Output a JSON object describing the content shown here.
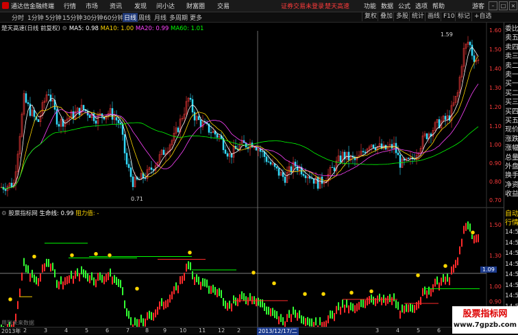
{
  "menubar": {
    "app_title": "通达信金融终端",
    "items": [
      "行情",
      "市场",
      "资讯",
      "发现",
      "问小达",
      "财富圈",
      "交易"
    ],
    "alert_left": "证券交易未登录",
    "alert_right": "楚天高速",
    "right_items": [
      "功能",
      "数据",
      "公式",
      "选项",
      "帮助"
    ],
    "guest": "游客"
  },
  "toolbar": {
    "periods": [
      "分时",
      "1分钟",
      "5分钟",
      "15分钟",
      "30分钟",
      "60分钟",
      "日线",
      "周线",
      "月线",
      "多周期",
      "更多"
    ],
    "active_period": "日线",
    "tools": [
      "复权",
      "叠加",
      "多股",
      "统计",
      "画线",
      "F10",
      "标记",
      "+自选"
    ]
  },
  "main_info": {
    "title": "楚天高速(日线 前复权)",
    "ma5": "MA5: 0.98",
    "ma10": "MA10: 1.00",
    "ma20": "MA20: 0.99",
    "ma60": "MA60: 1.01"
  },
  "main_axis": [
    "1.60",
    "1.50",
    "1.40",
    "1.30",
    "1.20",
    "1.10",
    "1.00",
    "0.90",
    "0.80",
    "0.70"
  ],
  "annotations": {
    "high": "1.59",
    "low": "0.71"
  },
  "sub_info": {
    "title": "股票指标网",
    "life_line": "生命线: 0.99",
    "resistance": "阻力值: -"
  },
  "sub_axis": [
    "1.50",
    "1.30",
    "1.09",
    "1.00",
    "0.90"
  ],
  "sub_axis_highlight": "1.09",
  "right_panel": [
    "委比",
    "卖五",
    "卖四",
    "卖三",
    "卖二",
    "卖一",
    "买一",
    "买二",
    "买三",
    "买四",
    "买五",
    "现价",
    "涨跌",
    "涨幅",
    "总量",
    "外盘",
    "换手",
    "净资",
    "收益"
  ],
  "right_panel2": [
    "自动",
    "行情",
    "14:50",
    "14:50",
    "14:50",
    "14:50",
    "14:50",
    "14:50",
    "14:50",
    "14:50"
  ],
  "bottom": {
    "year_label": "2013年",
    "dates": [
      "2",
      "3",
      "4",
      "5",
      "6",
      "7",
      "8",
      "9",
      "10",
      "11",
      "12",
      "2",
      "3",
      "4",
      "5",
      "6",
      "7",
      "8",
      "9"
    ],
    "selected_date": "2013/12/17/二",
    "no_data_hint": "用到未来数据"
  },
  "watermark": {
    "line1": "股票指标网",
    "line2": "www.7gpzb.com"
  },
  "colors": {
    "up": "#ff3c3c",
    "down": "#00ff66",
    "ma5": "#ffffff",
    "ma10": "#ffd700",
    "ma20": "#ff44ff",
    "ma60": "#00ff00"
  }
}
